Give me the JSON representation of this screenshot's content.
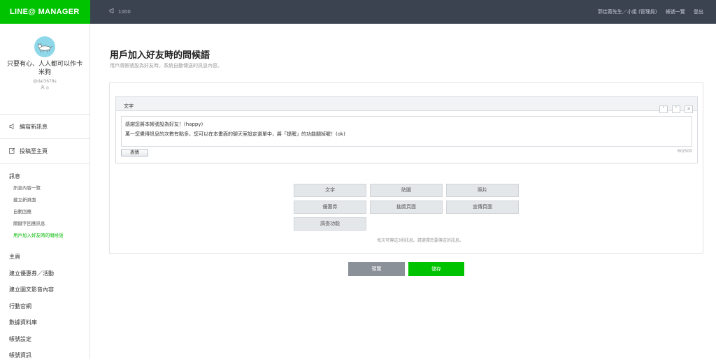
{
  "app": {
    "logo": "LINE@ MANAGER",
    "message_count": "1000"
  },
  "topnav": {
    "user": "郭佳蓉先生／小姐 (管理員)",
    "accounts": "帳號一覽",
    "logout": "登出"
  },
  "account": {
    "name": "只要有心、人人都可以作卡米狗",
    "id": "@dal3678s",
    "friends": "0"
  },
  "sidebar": {
    "compose": "編寫新訊息",
    "post": "投稿至主頁",
    "messages": {
      "title": "訊息",
      "items": [
        "訊息內容一覽",
        "建立新頁面",
        "自動回應",
        "關鍵字回應訊息",
        "用戶加入好友時的問候語"
      ]
    },
    "nav": [
      "主頁",
      "建立優惠券／活動",
      "建立圖文影音內容",
      "行動官網",
      "數據資料庫",
      "帳號設定",
      "帳號資訊"
    ]
  },
  "page": {
    "title": "用戶加入好友時的問候語",
    "description": "用戶將帳號設為好友時，系統自動傳送的訊息內容。"
  },
  "editor": {
    "label": "文字",
    "line1": "感謝您將本帳號設為好友！(happy)",
    "line2": "萬一您覺得訊息的次數有點多，您可以在本畫面的聊天室設定選單中，將「提醒」的功能關掉喔！(ok)",
    "emoji_button": "表情",
    "counter": "60/500"
  },
  "content_buttons": [
    "文字",
    "貼圖",
    "照片",
    "優惠券",
    "抽獎頁面",
    "宣傳頁面",
    "調查功能"
  ],
  "note": "每次可傳送3則訊息。請選擇您要傳送的訊息。",
  "actions": {
    "preview": "預覽",
    "save": "儲存"
  }
}
